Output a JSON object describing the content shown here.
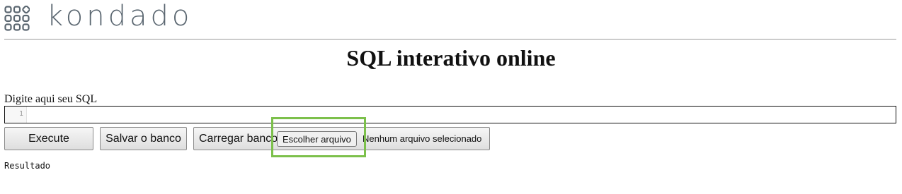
{
  "header": {
    "logo_text": "kondado",
    "logo_icon": "grid-3x3-logo-icon",
    "logo_color": "#5a6670"
  },
  "page": {
    "title": "SQL interativo online"
  },
  "editor": {
    "label": "Digite aqui seu SQL",
    "line_number": "1",
    "content": ""
  },
  "toolbar": {
    "execute_label": "Execute",
    "save_label": "Salvar o banco",
    "load_label": "Carregar banco",
    "file_button_label": "Escolher arquivo",
    "file_status": "Nenhum arquivo selecionado"
  },
  "result": {
    "label": "Resultado"
  },
  "colors": {
    "highlight": "#7cc04b",
    "divider": "#9a9a9a"
  }
}
